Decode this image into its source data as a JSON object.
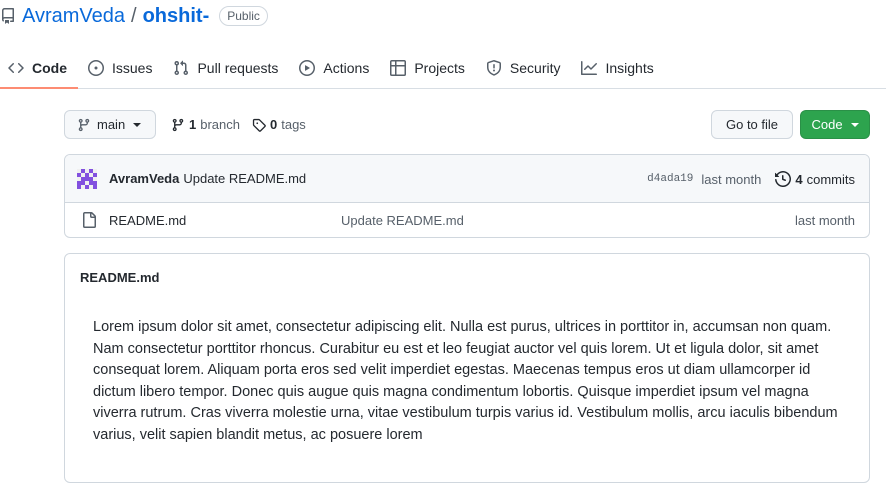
{
  "repo": {
    "owner": "AvramVeda",
    "separator": "/",
    "name": "ohshit-",
    "visibility": "Public"
  },
  "tabs": [
    {
      "label": "Code",
      "icon": "code-icon",
      "selected": true
    },
    {
      "label": "Issues",
      "icon": "issue-icon",
      "selected": false
    },
    {
      "label": "Pull requests",
      "icon": "pull-request-icon",
      "selected": false
    },
    {
      "label": "Actions",
      "icon": "play-icon",
      "selected": false
    },
    {
      "label": "Projects",
      "icon": "table-icon",
      "selected": false
    },
    {
      "label": "Security",
      "icon": "shield-icon",
      "selected": false
    },
    {
      "label": "Insights",
      "icon": "graph-icon",
      "selected": false
    }
  ],
  "branch_bar": {
    "branch": "main",
    "branch_count": "1",
    "branch_label": "branch",
    "tag_count": "0",
    "tag_label": "tags",
    "goto_label": "Go to file",
    "code_label": "Code"
  },
  "latest_commit": {
    "author": "AvramVeda",
    "message": "Update README.md",
    "sha": "d4ada19",
    "age": "last month",
    "commit_count": "4",
    "commit_label": "commits"
  },
  "files": [
    {
      "name": "README.md",
      "commit_message": "Update README.md",
      "age": "last month"
    }
  ],
  "readme": {
    "title": "README.md",
    "body": "Lorem ipsum dolor sit amet, consectetur adipiscing elit. Nulla est purus, ultrices in porttitor in, accumsan non quam. Nam consectetur porttitor rhoncus. Curabitur eu est et leo feugiat auctor vel quis lorem. Ut et ligula dolor, sit amet consequat lorem. Aliquam porta eros sed velit imperdiet egestas. Maecenas tempus eros ut diam ullamcorper id dictum libero tempor. Donec quis augue quis magna condimentum lobortis. Quisque imperdiet ipsum vel magna viverra rutrum. Cras viverra molestie urna, vitae vestibulum turpis varius id. Vestibulum mollis, arcu iaculis bibendum varius, velit sapien blandit metus, ac posuere lorem"
  },
  "colors": {
    "link": "#0969da",
    "tab_underline": "#fd8c73",
    "primary_button": "#2da44e",
    "avatar": "#8250df"
  }
}
